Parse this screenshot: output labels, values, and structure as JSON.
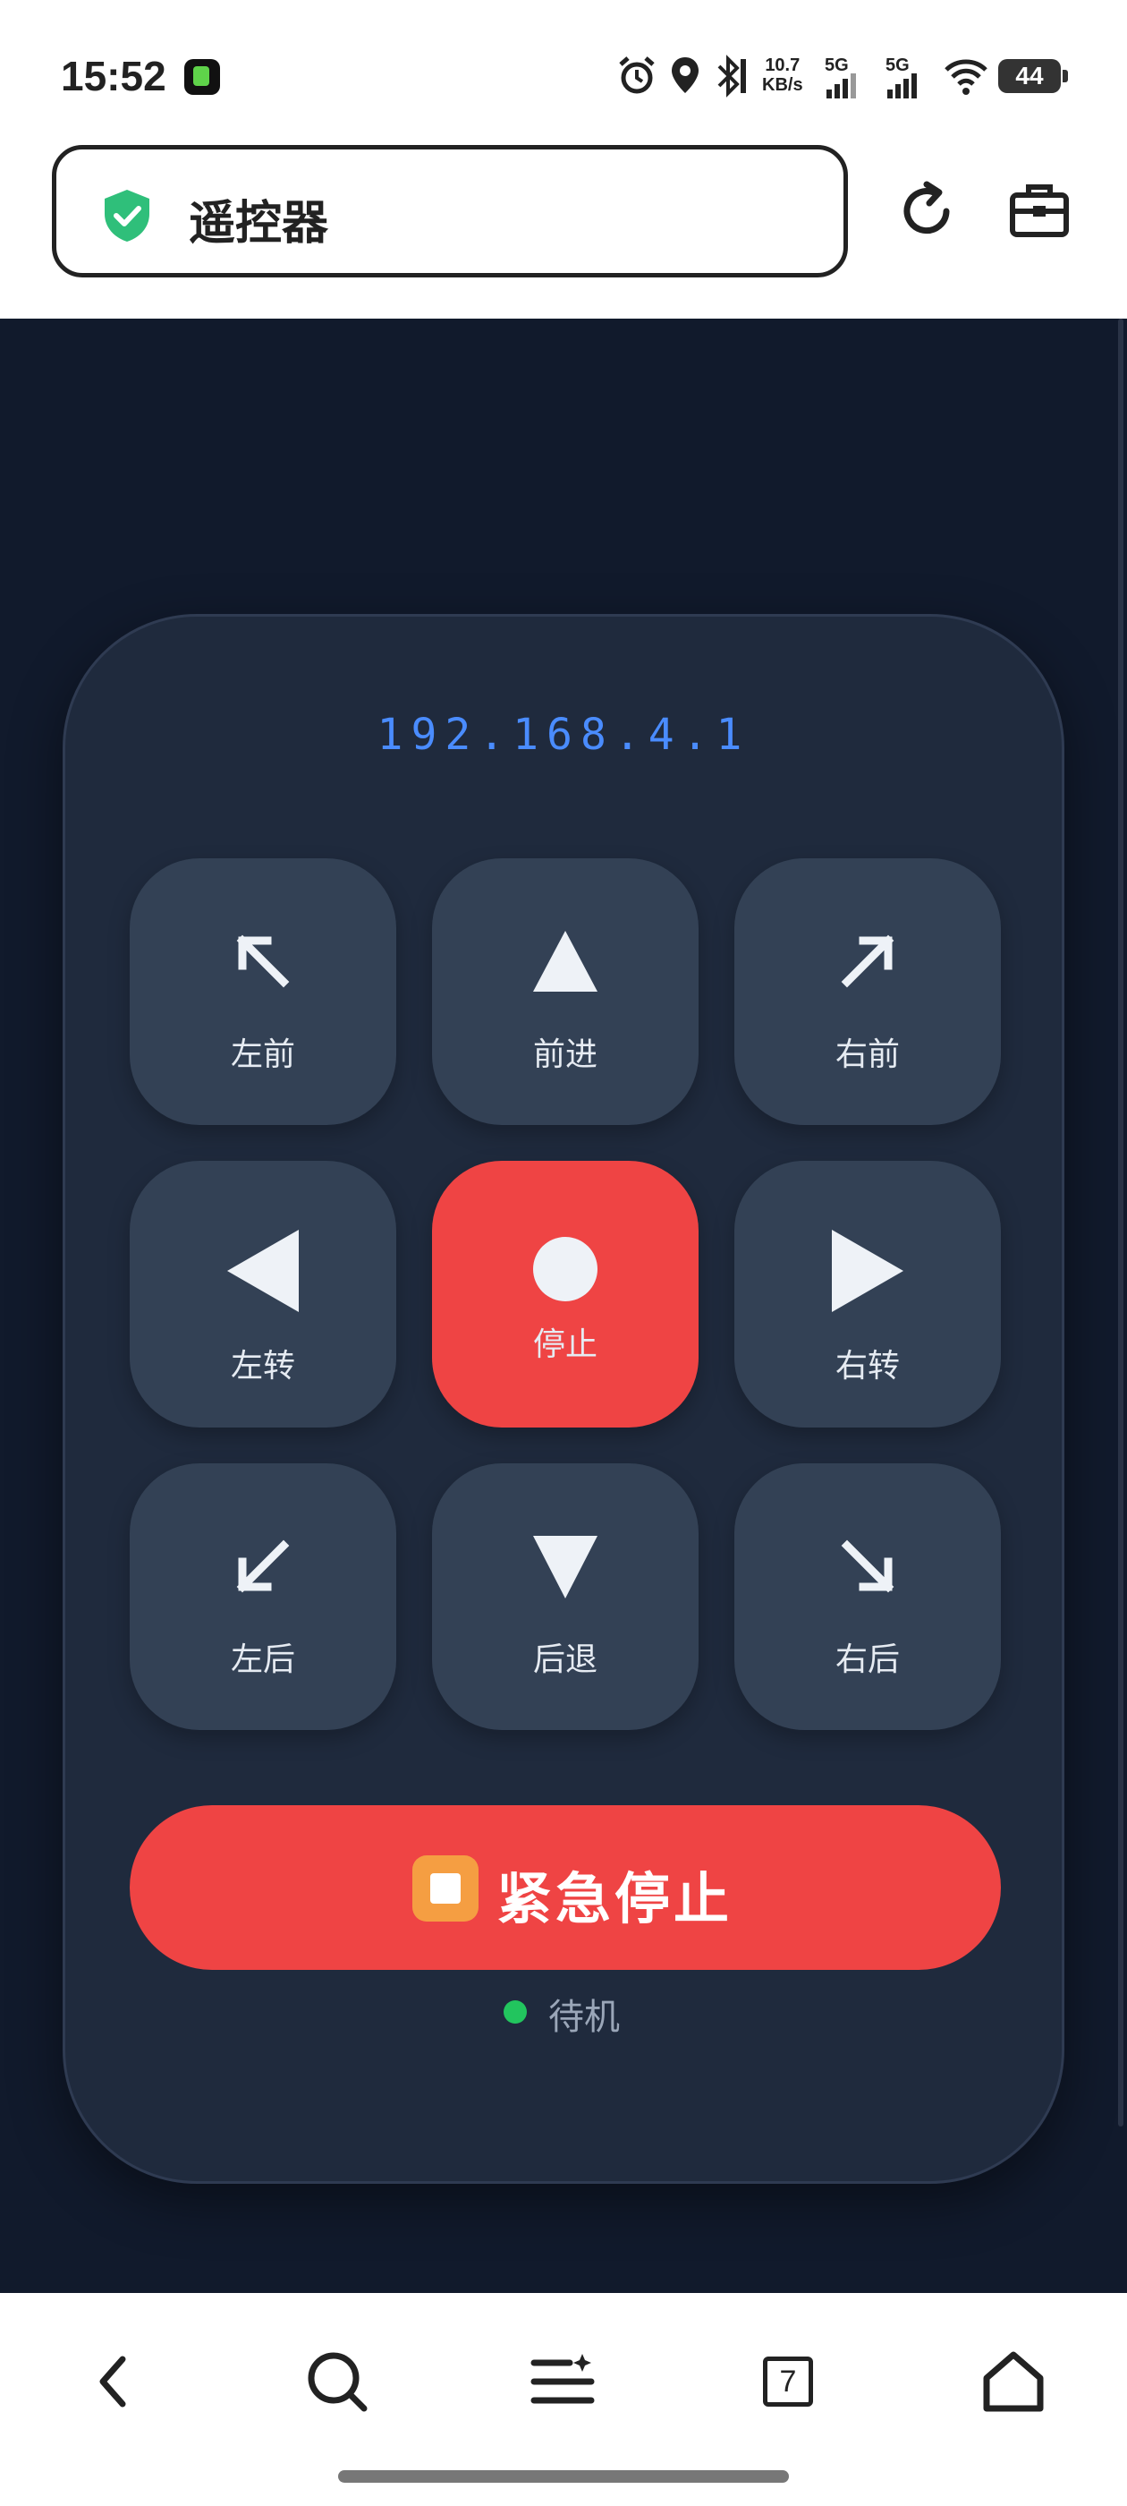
{
  "status_bar": {
    "time": "15:52",
    "net_speed_value": "10.7",
    "net_speed_unit": "KB/s",
    "sim1_label": "5G",
    "sim2_label": "5G",
    "battery": "44",
    "icons": [
      "alarm-icon",
      "location-icon",
      "bluetooth-icon",
      "signal-icon",
      "wifi-icon",
      "battery-icon"
    ]
  },
  "browser": {
    "page_title": "遥控器",
    "secure_icon": "shield-check-icon",
    "actions": [
      "reload-icon",
      "toolbox-icon"
    ]
  },
  "remote": {
    "ip": "192.168.4.1",
    "buttons": [
      {
        "label": "左前",
        "icon": "arrow-up-left-icon"
      },
      {
        "label": "前进",
        "icon": "triangle-up-icon"
      },
      {
        "label": "右前",
        "icon": "arrow-up-right-icon"
      },
      {
        "label": "左转",
        "icon": "triangle-left-icon"
      },
      {
        "label": "停止",
        "icon": "circle-stop-icon"
      },
      {
        "label": "右转",
        "icon": "triangle-right-icon"
      },
      {
        "label": "左后",
        "icon": "arrow-down-left-icon"
      },
      {
        "label": "后退",
        "icon": "triangle-down-icon"
      },
      {
        "label": "右后",
        "icon": "arrow-down-right-icon"
      }
    ],
    "emergency_label": "紧急停止",
    "status_text": "待机",
    "colors": {
      "background": "#111a2c",
      "card": "#1f2a3d",
      "button": "#334155",
      "stop": "#ef4444",
      "ip": "#4a8cff",
      "status_ok": "#22c55e"
    }
  },
  "bottom_nav": {
    "tab_count": "7",
    "items": [
      "back-icon",
      "search-icon",
      "menu-icon",
      "tabs-icon",
      "home-icon"
    ]
  }
}
